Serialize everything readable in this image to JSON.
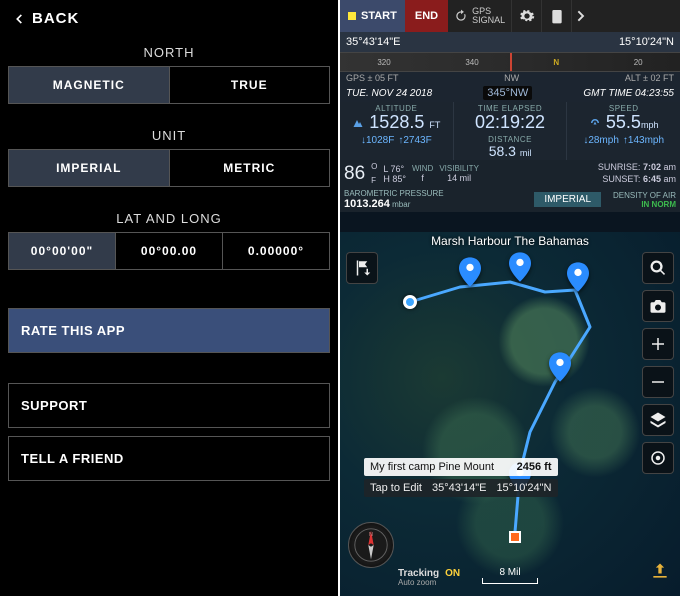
{
  "left": {
    "back": "BACK",
    "north": {
      "title": "NORTH",
      "opts": [
        "MAGNETIC",
        "TRUE"
      ],
      "selected": 0
    },
    "unit": {
      "title": "UNIT",
      "opts": [
        "IMPERIAL",
        "METRIC"
      ],
      "selected": 0
    },
    "latlong": {
      "title": "LAT AND LONG",
      "opts": [
        "00°00'00\"",
        "00°00.00",
        "0.00000°"
      ],
      "selected": 0
    },
    "rate": "RATE THIS APP",
    "support": "SUPPORT",
    "tell": "TELL A FRIEND"
  },
  "right": {
    "toolbar": {
      "start": "START",
      "end": "END",
      "gps_label": "GPS",
      "signal_label": "SIGNAL"
    },
    "coords": {
      "lat": "35°43'14\"E",
      "lon": "15°10'24\"N"
    },
    "ruler": {
      "ticks": [
        "320",
        "340",
        "N",
        "20"
      ]
    },
    "subrow": {
      "gps_err": "GPS ± 05 FT",
      "nw": "NW",
      "alt_err": "ALT ± 02 FT"
    },
    "date": {
      "day": "TUE.  NOV 24 2018",
      "bearing": "345°NW",
      "gmt": "GMT TIME  04:23:55"
    },
    "stats": {
      "altitude_lbl": "ALTITUDE",
      "altitude_val": "1528.5",
      "altitude_unit": "FT",
      "elapsed_lbl": "TIME ELAPSED",
      "elapsed_val": "02:19:22",
      "speed_lbl": "SPEED",
      "speed_val": "55.5",
      "speed_unit": "mph",
      "alt_down": "1028F",
      "alt_up": "2743F",
      "dist_lbl": "DISTANCE",
      "dist_val": "58.3",
      "dist_unit": "mil",
      "spd_down": "28mph",
      "spd_up": "143mph"
    },
    "temp": {
      "main": "86",
      "deg_top": "O",
      "deg_bot": "F",
      "l": "L 76°",
      "h": "H 85°",
      "wind_lbl": "WIND",
      "wind_val": "f",
      "vis_lbl": "VISIBILITY",
      "vis_val": "14",
      "vis_unit": "mil",
      "sunrise_lbl": "SUNRISE:",
      "sunrise_val": "7:02",
      "sunrise_ampm": "am",
      "sunset_lbl": "SUNSET:",
      "sunset_val": "6:45",
      "sunset_ampm": "am"
    },
    "baro": {
      "lbl": "BAROMETRIC PRESSURE",
      "val": "1013.264",
      "unit": "mbar",
      "imperial_btn": "IMPERIAL",
      "dens_lbl": "DENSITY OF AIR",
      "dens_val": "IN NORM"
    },
    "location": "Marsh Harbour The Bahamas",
    "callout": {
      "title": "My first camp Pine Mount",
      "alt": "2456 ft",
      "tap": "Tap to Edit",
      "c_lat": "35°43'14\"E",
      "c_lon": "15°10'24\"N"
    },
    "tracking": {
      "lbl": "Tracking",
      "mode": "Auto zoom",
      "state": "ON"
    },
    "scale": "8 Mil"
  }
}
